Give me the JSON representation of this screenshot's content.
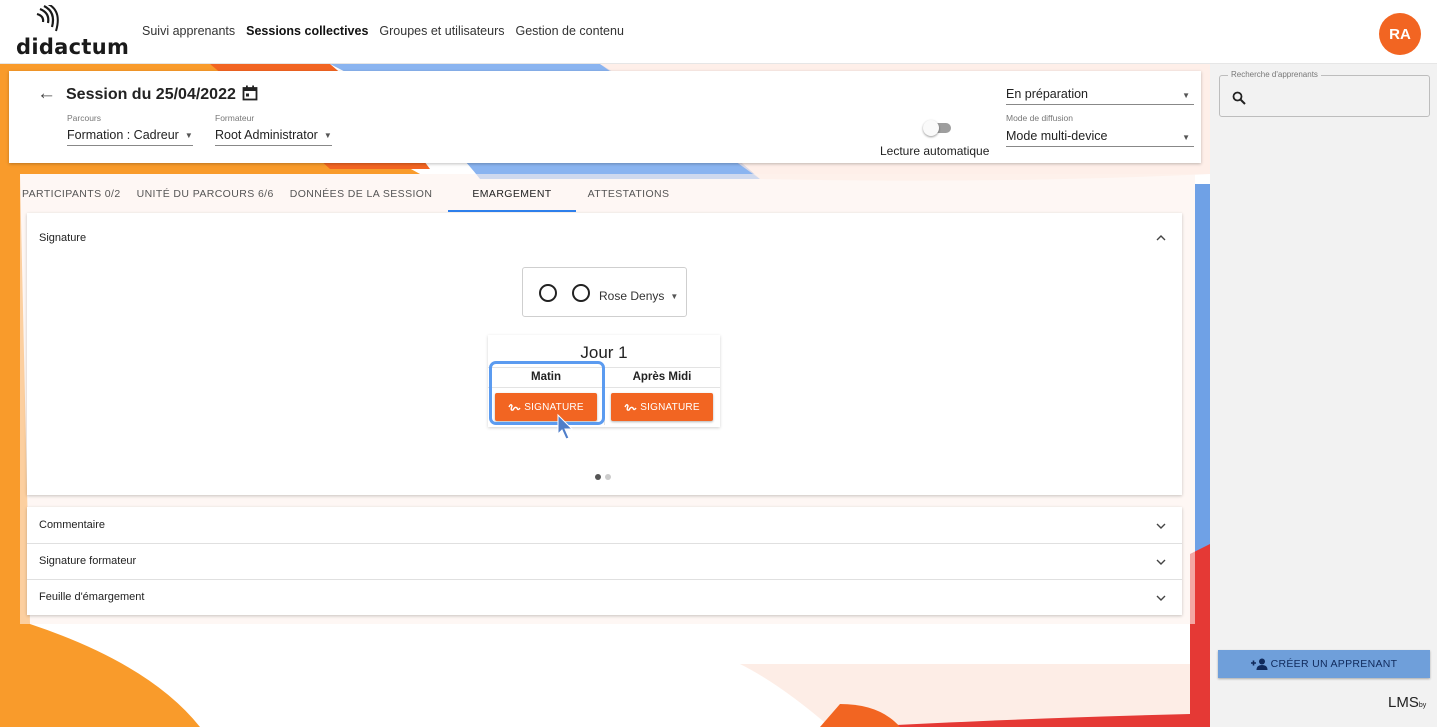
{
  "brand": {
    "logo_text": "didactum"
  },
  "nav": {
    "items": [
      "Suivi apprenants",
      "Sessions collectives",
      "Groupes et utilisateurs",
      "Gestion de contenu"
    ],
    "active_index": 1
  },
  "user": {
    "initials": "RA"
  },
  "session": {
    "title": "Session du 25/04/2022",
    "parcours_label": "Parcours",
    "parcours_value": "Formation : Cadreur",
    "formateur_label": "Formateur",
    "formateur_value": "Root Administrator",
    "auto_play_label": "Lecture automatique",
    "status_value": "En préparation",
    "diffusion_label": "Mode de diffusion",
    "diffusion_value": "Mode multi-device"
  },
  "tabs": [
    {
      "label": "PARTICIPANTS 0/2"
    },
    {
      "label": "UNITÉ DU PARCOURS 6/6"
    },
    {
      "label": "DONNÉES DE LA SESSION"
    },
    {
      "label": "EMARGEMENT"
    },
    {
      "label": "ATTESTATIONS"
    }
  ],
  "active_tab": 3,
  "signature_panel": {
    "title": "Signature",
    "signer": "Rose Denys",
    "day_title": "Jour 1",
    "morning_label": "Matin",
    "afternoon_label": "Après Midi",
    "button_label": "SIGNATURE",
    "carousel_pages": 2,
    "carousel_active": 0
  },
  "panels": [
    {
      "title": "Commentaire"
    },
    {
      "title": "Signature formateur"
    },
    {
      "title": "Feuille d'émargement"
    }
  ],
  "sidebar": {
    "search_legend": "Recherche d'apprenants",
    "create_label": "CRÉER UN APPRENANT",
    "footer_logo": "LMS",
    "footer_sub": "by"
  },
  "colors": {
    "accent_orange": "#f26522",
    "accent_blue": "#2f80ed",
    "create_button": "#6f9fda",
    "highlight": "#5b9bf0"
  },
  "icons": [
    "back-arrow-icon",
    "calendar-icon",
    "chevron-up-icon",
    "chevron-down-icon",
    "signature-icon",
    "search-icon",
    "add-person-icon",
    "cursor-icon"
  ]
}
